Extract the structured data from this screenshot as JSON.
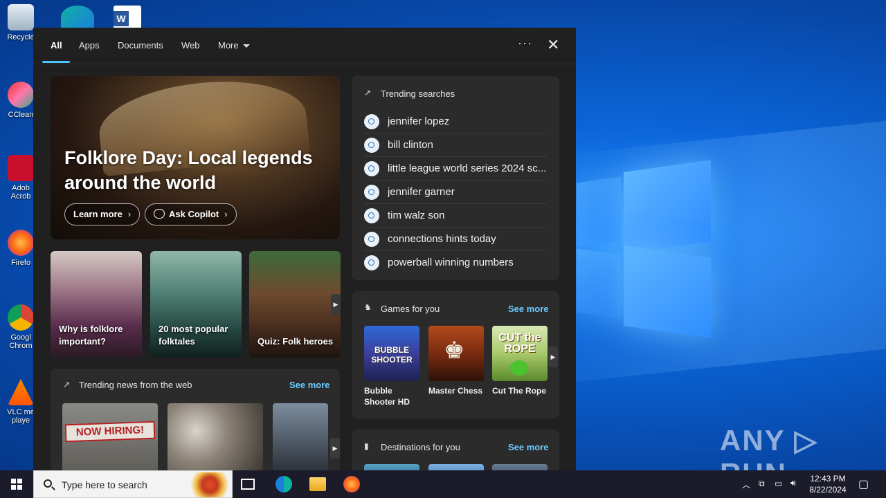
{
  "desktop": {
    "icons": [
      {
        "label": "Recycle",
        "name": "recycle-bin"
      },
      {
        "label": "CClean",
        "name": "ccleaner"
      },
      {
        "label": "Adob Acrob",
        "name": "adobe-acrobat"
      },
      {
        "label": "Firefo",
        "name": "firefox"
      },
      {
        "label": "Googl Chrom",
        "name": "google-chrome"
      },
      {
        "label": "VLC me playe",
        "name": "vlc-media-player"
      }
    ],
    "watermark": "ANY ▷ RUN"
  },
  "search_panel": {
    "tabs": [
      "All",
      "Apps",
      "Documents",
      "Web",
      "More"
    ],
    "hero": {
      "title": "Folklore Day: Local legends around the world",
      "learn_more": "Learn more",
      "ask_copilot": "Ask Copilot"
    },
    "cards": [
      {
        "label": "Why is folklore important?"
      },
      {
        "label": "20 most popular folktales"
      },
      {
        "label": "Quiz: Folk heroes"
      }
    ],
    "trending_news": {
      "title": "Trending news from the web",
      "see_more": "See more",
      "sign_text": "NOW HIRING!"
    },
    "trending_searches": {
      "title": "Trending searches",
      "items": [
        "jennifer lopez",
        "bill clinton",
        "little league world series 2024 sc...",
        "jennifer garner",
        "tim walz son",
        "connections hints today",
        "powerball winning numbers"
      ]
    },
    "games": {
      "title": "Games for you",
      "see_more": "See more",
      "items": [
        {
          "name": "Bubble Shooter HD",
          "art": "BUBBLE SHOOTER"
        },
        {
          "name": "Master Chess",
          "art": "♚"
        },
        {
          "name": "Cut The Rope",
          "art": "CUT the ROPE"
        }
      ]
    },
    "destinations": {
      "title": "Destinations for you",
      "see_more": "See more"
    }
  },
  "taskbar": {
    "search_placeholder": "Type here to search",
    "time": "12:43 PM",
    "date": "8/22/2024"
  }
}
